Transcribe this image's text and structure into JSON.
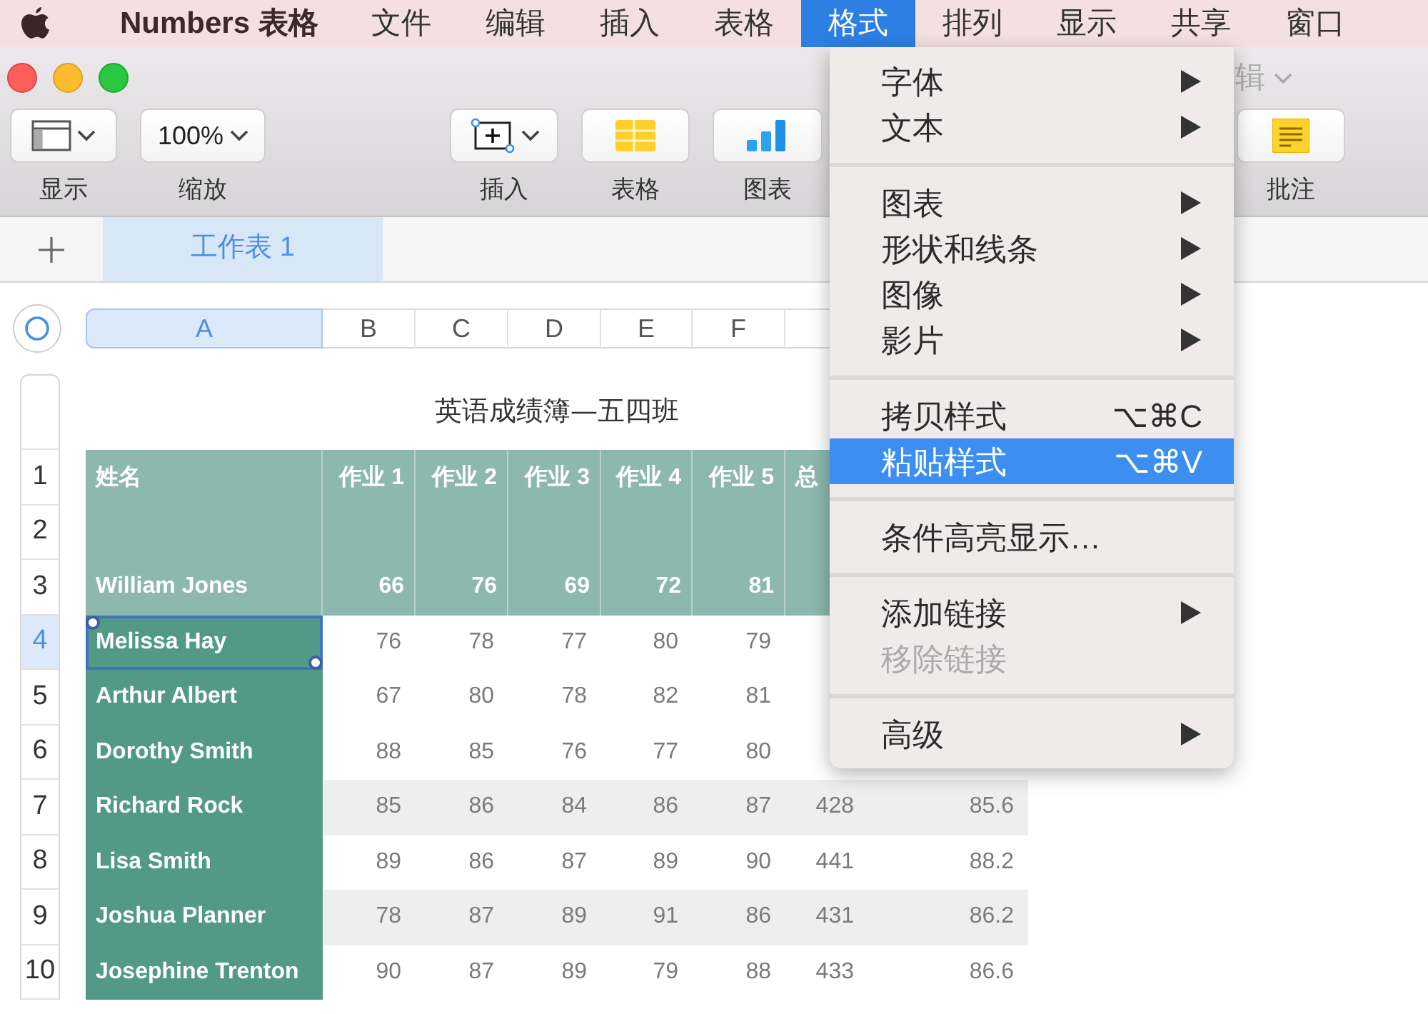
{
  "menu_bar": {
    "app": "Numbers 表格",
    "items": [
      {
        "label": "文件",
        "selected": false
      },
      {
        "label": "编辑",
        "selected": false
      },
      {
        "label": "插入",
        "selected": false
      },
      {
        "label": "表格",
        "selected": false
      },
      {
        "label": "格式",
        "selected": true
      },
      {
        "label": "排列",
        "selected": false
      },
      {
        "label": "显示",
        "selected": false
      },
      {
        "label": "共享",
        "selected": false
      },
      {
        "label": "窗口",
        "selected": false
      }
    ]
  },
  "window": {
    "title_partial": "辑"
  },
  "toolbar": {
    "buttons": [
      {
        "kind": "view",
        "label": "显示"
      },
      {
        "kind": "zoom",
        "value": "100%",
        "label": "缩放"
      },
      {
        "kind": "insert",
        "label": "插入"
      },
      {
        "kind": "table",
        "label": "表格"
      },
      {
        "kind": "chart",
        "label": "图表"
      },
      {
        "kind": "comment",
        "label": "批注"
      }
    ]
  },
  "sheet_tabs": [
    {
      "label": "工作表 1",
      "selected": true
    }
  ],
  "spreadsheet": {
    "columns": [
      {
        "letter": "A",
        "selected": true
      },
      {
        "letter": "B",
        "selected": false
      },
      {
        "letter": "C",
        "selected": false
      },
      {
        "letter": "D",
        "selected": false
      },
      {
        "letter": "E",
        "selected": false
      },
      {
        "letter": "F",
        "selected": false
      }
    ],
    "title": "英语成绩簿—五四班",
    "header_rows": [
      {
        "number": "1",
        "cells": [
          "姓名",
          "作业 1",
          "作业 2",
          "作业 3",
          "作业 4",
          "作业 5",
          "总"
        ]
      },
      {
        "number": "2"
      },
      {
        "number": "3",
        "cells": [
          "William Jones",
          "66",
          "76",
          "69",
          "72",
          "81"
        ]
      }
    ],
    "rows": [
      {
        "number": "4",
        "selected": true,
        "cells": [
          "Melissa Hay",
          "76",
          "78",
          "77",
          "80",
          "79"
        ]
      },
      {
        "number": "5",
        "selected": false,
        "cells": [
          "Arthur Albert",
          "67",
          "80",
          "78",
          "82",
          "81"
        ]
      },
      {
        "number": "6",
        "selected": false,
        "cells": [
          "Dorothy Smith",
          "88",
          "85",
          "76",
          "77",
          "80"
        ]
      },
      {
        "number": "7",
        "selected": false,
        "cells": [
          "Richard Rock",
          "85",
          "86",
          "84",
          "86",
          "87",
          "428",
          "85.6"
        ]
      },
      {
        "number": "8",
        "selected": false,
        "cells": [
          "Lisa Smith",
          "89",
          "86",
          "87",
          "89",
          "90",
          "441",
          "88.2"
        ]
      },
      {
        "number": "9",
        "selected": false,
        "cells": [
          "Joshua Planner",
          "78",
          "87",
          "89",
          "91",
          "86",
          "431",
          "86.2"
        ]
      },
      {
        "number": "10",
        "selected": false,
        "cells": [
          "Josephine Trenton",
          "90",
          "87",
          "89",
          "79",
          "88",
          "433",
          "86.6"
        ]
      }
    ]
  },
  "format_menu": {
    "items": [
      {
        "kind": "item",
        "label": "字体",
        "submenu": true,
        "selected": false,
        "disabled": false
      },
      {
        "kind": "item",
        "label": "文本",
        "submenu": true,
        "selected": false,
        "disabled": false
      },
      {
        "kind": "separator"
      },
      {
        "kind": "item",
        "label": "图表",
        "submenu": true,
        "selected": false,
        "disabled": false
      },
      {
        "kind": "item",
        "label": "形状和线条",
        "submenu": true,
        "selected": false,
        "disabled": false
      },
      {
        "kind": "item",
        "label": "图像",
        "submenu": true,
        "selected": false,
        "disabled": false
      },
      {
        "kind": "item",
        "label": "影片",
        "submenu": true,
        "selected": false,
        "disabled": false
      },
      {
        "kind": "separator"
      },
      {
        "kind": "item",
        "label": "拷贝样式",
        "shortcut": "⌥⌘C",
        "submenu": false,
        "selected": false,
        "disabled": false
      },
      {
        "kind": "item",
        "label": "粘贴样式",
        "shortcut": "⌥⌘V",
        "submenu": false,
        "selected": true,
        "disabled": false
      },
      {
        "kind": "separator"
      },
      {
        "kind": "item",
        "label": "条件高亮显示…",
        "submenu": false,
        "selected": false,
        "disabled": false
      },
      {
        "kind": "separator"
      },
      {
        "kind": "item",
        "label": "添加链接",
        "submenu": true,
        "selected": false,
        "disabled": false
      },
      {
        "kind": "item",
        "label": "移除链接",
        "submenu": false,
        "selected": false,
        "disabled": true
      },
      {
        "kind": "separator"
      },
      {
        "kind": "item",
        "label": "高级",
        "submenu": true,
        "selected": false,
        "disabled": false
      }
    ]
  }
}
